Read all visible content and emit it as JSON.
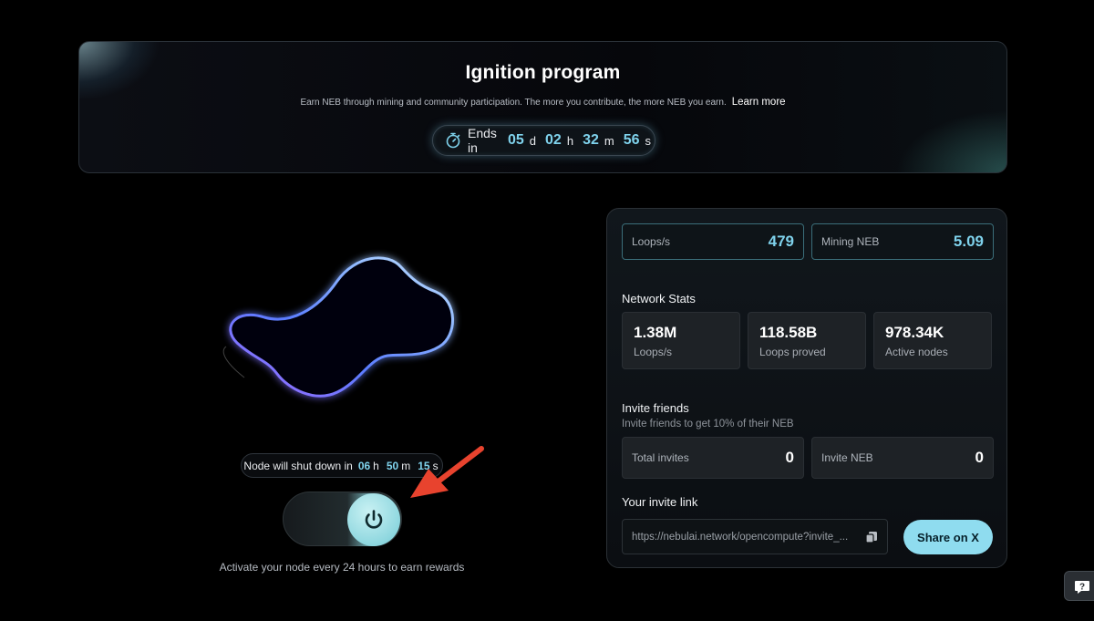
{
  "banner": {
    "title": "Ignition program",
    "subtitle": "Earn NEB through mining and community participation. The more you contribute, the more NEB you earn.",
    "learn_more": "Learn more",
    "countdown": {
      "label": "Ends in",
      "days": "05",
      "days_unit": "d",
      "hours": "02",
      "hours_unit": "h",
      "minutes": "32",
      "minutes_unit": "m",
      "seconds": "56",
      "seconds_unit": "s"
    }
  },
  "node": {
    "shutdown_label": "Node will shut down in",
    "hours": "06",
    "hours_unit": "h",
    "minutes": "50",
    "minutes_unit": "m",
    "seconds": "15",
    "seconds_unit": "s",
    "activate_text": "Activate your node every 24 hours to earn rewards"
  },
  "panel": {
    "loops": {
      "label": "Loops/s",
      "value": "479"
    },
    "mining": {
      "label": "Mining NEB",
      "value": "5.09"
    },
    "network_title": "Network Stats",
    "network": [
      {
        "value": "1.38M",
        "label": "Loops/s"
      },
      {
        "value": "118.58B",
        "label": "Loops proved"
      },
      {
        "value": "978.34K",
        "label": "Active nodes"
      }
    ],
    "invite_title": "Invite friends",
    "invite_sub": "Invite friends to get 10% of their NEB",
    "total_invites": {
      "label": "Total invites",
      "value": "0"
    },
    "invite_neb": {
      "label": "Invite NEB",
      "value": "0"
    },
    "link_title": "Your invite link",
    "link_value": "https://nebulai.network/opencompute?invite_...",
    "share_label": "Share on X"
  },
  "colors": {
    "accent": "#7fd2ec",
    "arrow": "#e8432e",
    "toggle_knob": "#8ed7df"
  }
}
